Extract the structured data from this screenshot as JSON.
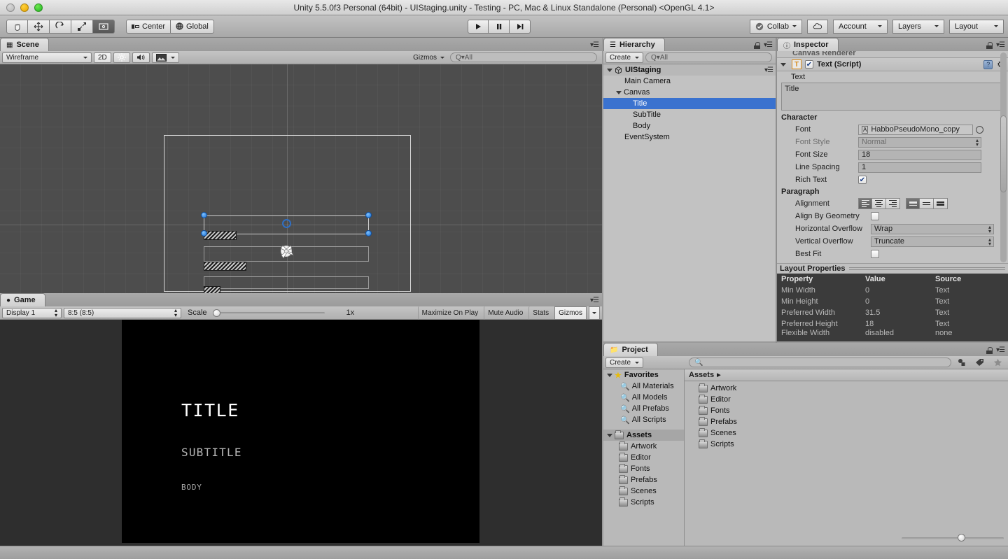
{
  "window": {
    "title": "Unity 5.5.0f3 Personal (64bit) - UIStaging.unity - Testing - PC, Mac & Linux Standalone (Personal) <OpenGL 4.1>"
  },
  "toolbar": {
    "tools": [
      "hand-tool",
      "move-tool",
      "rotate-tool",
      "scale-tool",
      "rect-tool"
    ],
    "pivot_label": "Center",
    "space_label": "Global",
    "play_label": "▶",
    "pause_label": "❚❚",
    "step_label": "▶❘",
    "collab_label": "Collab",
    "cloud_label": "☁",
    "account_label": "Account",
    "layers_label": "Layers",
    "layout_label": "Layout"
  },
  "scene": {
    "tab_label": "Scene",
    "draw_mode": "Wireframe",
    "toggle_2d": "2D",
    "gizmos_label": "Gizmos",
    "search_placeholder": "Q▾All",
    "light_icon": "☀",
    "audio_icon": "⧹))",
    "fx_icon": "▣"
  },
  "game": {
    "tab_label": "Game",
    "display_label": "Display 1",
    "aspect_label": "8:5 (8:5)",
    "scale_label": "Scale",
    "scale_value": "1x",
    "maximize_label": "Maximize On Play",
    "mute_label": "Mute Audio",
    "stats_label": "Stats",
    "gizmos_label": "Gizmos",
    "render": {
      "title": "TITLE",
      "subtitle": "SUBTITLE",
      "body": "BODY"
    }
  },
  "hierarchy": {
    "tab_label": "Hierarchy",
    "create_label": "Create",
    "search_placeholder": "Q▾All",
    "items": [
      {
        "label": "UIStaging",
        "depth": 0,
        "arrow": "open",
        "icon": "scene-icon",
        "selected": false
      },
      {
        "label": "Main Camera",
        "depth": 1,
        "arrow": "none",
        "icon": "",
        "selected": false
      },
      {
        "label": "Canvas",
        "depth": 1,
        "arrow": "open",
        "icon": "",
        "selected": false
      },
      {
        "label": "Title",
        "depth": 2,
        "arrow": "none",
        "icon": "",
        "selected": true
      },
      {
        "label": "SubTitle",
        "depth": 2,
        "arrow": "none",
        "icon": "",
        "selected": false
      },
      {
        "label": "Body",
        "depth": 2,
        "arrow": "none",
        "icon": "",
        "selected": false
      },
      {
        "label": "EventSystem",
        "depth": 1,
        "arrow": "none",
        "icon": "",
        "selected": false
      }
    ]
  },
  "inspector": {
    "tab_label": "Inspector",
    "clipped_component": "Canvas Renderer",
    "component_title": "Text (Script)",
    "component_badge": "T",
    "text_section_label": "Text",
    "text_value": "Title",
    "character_label": "Character",
    "fields": [
      {
        "label": "Font",
        "value": "HabboPseudoMono_copy",
        "type": "object",
        "dim": false
      },
      {
        "label": "Font Style",
        "value": "Normal",
        "type": "popup",
        "dim": true
      },
      {
        "label": "Font Size",
        "value": "18",
        "type": "text",
        "dim": false
      },
      {
        "label": "Line Spacing",
        "value": "1",
        "type": "text",
        "dim": false
      },
      {
        "label": "Rich Text",
        "value": "✔",
        "type": "checkbox",
        "dim": false
      }
    ],
    "paragraph_label": "Paragraph",
    "paragraph_fields": [
      {
        "label": "Alignment",
        "value": "",
        "type": "align"
      },
      {
        "label": "Align By Geometry",
        "value": "",
        "type": "checkbox-off"
      },
      {
        "label": "Horizontal Overflow",
        "value": "Wrap",
        "type": "popup"
      },
      {
        "label": "Vertical Overflow",
        "value": "Truncate",
        "type": "popup"
      },
      {
        "label": "Best Fit",
        "value": "",
        "type": "checkbox-off"
      }
    ],
    "layout_properties": {
      "title": "Layout Properties",
      "headers": [
        "Property",
        "Value",
        "Source"
      ],
      "rows": [
        [
          "Min Width",
          "0",
          "Text"
        ],
        [
          "Min Height",
          "0",
          "Text"
        ],
        [
          "Preferred Width",
          "31.5",
          "Text"
        ],
        [
          "Preferred Height",
          "18",
          "Text"
        ],
        [
          "Flexible Width",
          "disabled",
          "none"
        ]
      ]
    }
  },
  "project": {
    "tab_label": "Project",
    "create_label": "Create",
    "search_placeholder": "",
    "breadcrumb": "Assets",
    "breadcrumb_arrow": "▶",
    "favorites_label": "Favorites",
    "favorites": [
      "All Materials",
      "All Models",
      "All Prefabs",
      "All Scripts"
    ],
    "assets_label": "Assets",
    "assets_tree": [
      "Artwork",
      "Editor",
      "Fonts",
      "Prefabs",
      "Scenes",
      "Scripts"
    ],
    "assets_list": [
      "Artwork",
      "Editor",
      "Fonts",
      "Prefabs",
      "Scenes",
      "Scripts"
    ]
  },
  "colors": {
    "selection_blue": "#3a72cf",
    "handle_blue": "#1a6fd4",
    "chrome_grey": "#b4b4b4",
    "scene_bg": "#4d4d4d",
    "game_bg": "#000000",
    "layout_panel_bg": "#3b3b3b"
  }
}
